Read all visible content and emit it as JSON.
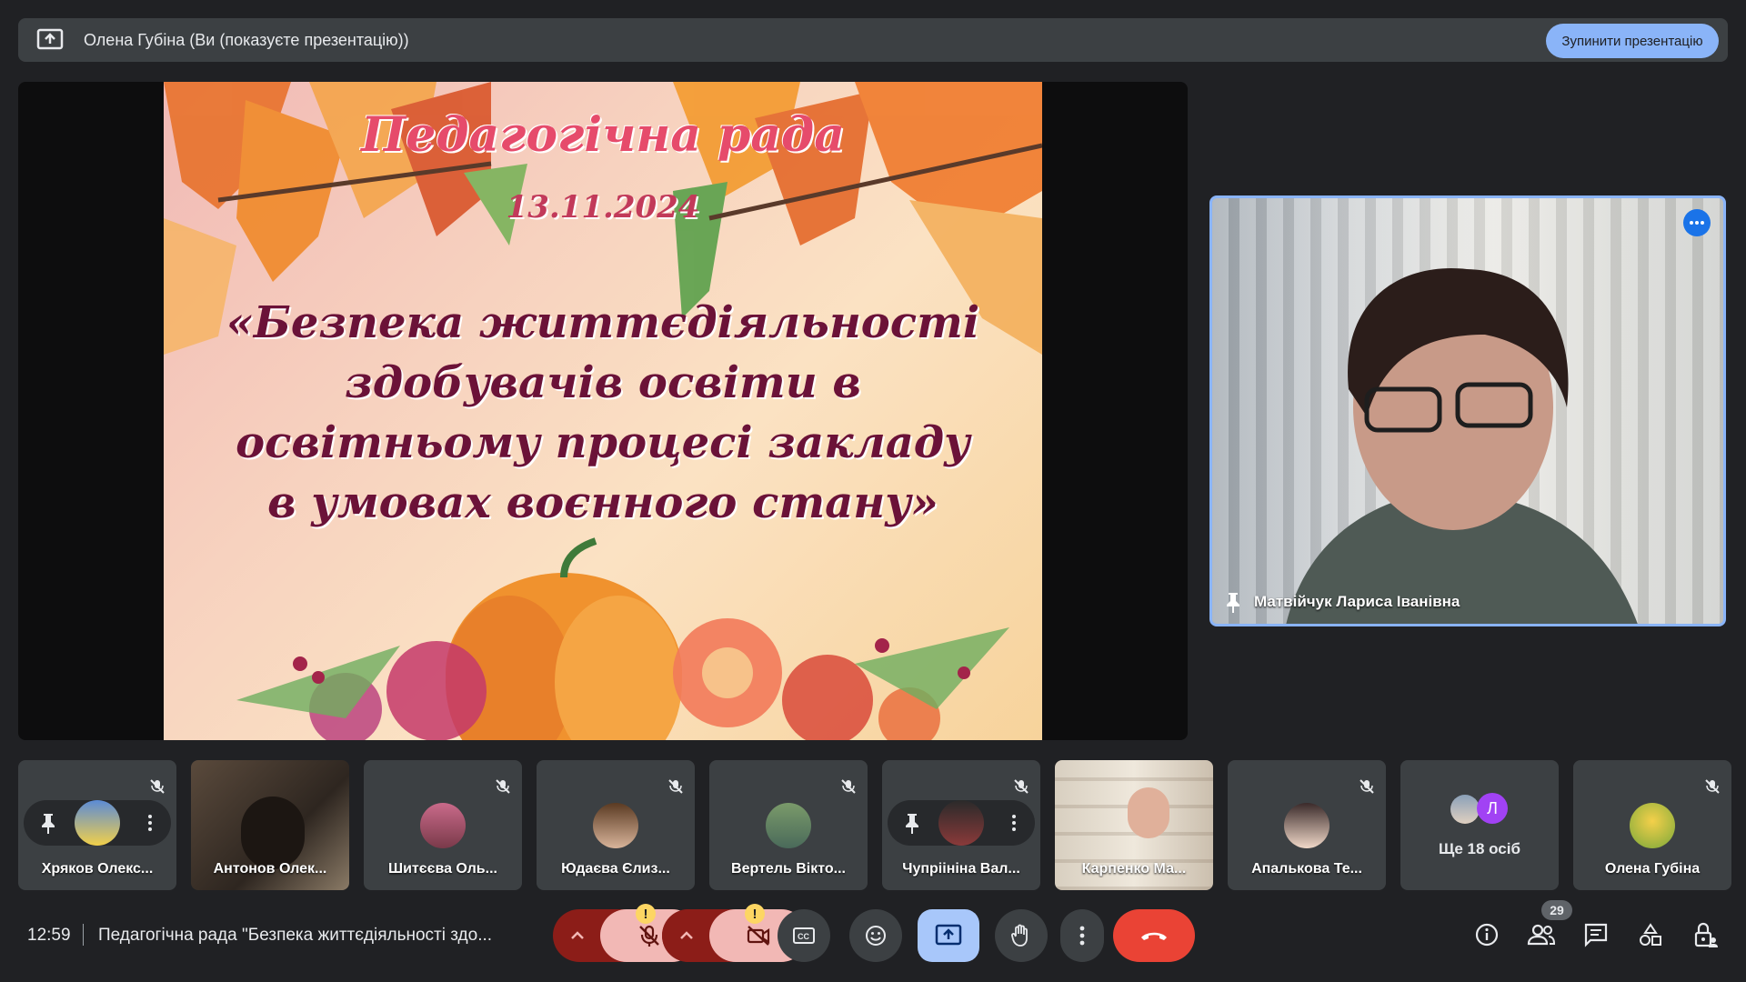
{
  "presenting_bar": {
    "label": "Олена Губіна (Ви (показуєте презентацію))",
    "stop_button": "Зупинити презентацію"
  },
  "slide": {
    "title": "Педагогічна рада",
    "date": "13.11.2024",
    "subtitle": "«Безпека життєдіяльності здобувачів освіти в освітньому процесі закладу в умовах воєнного стану»"
  },
  "pinned_speaker": {
    "name": "Матвійчук Лариса Іванівна"
  },
  "participants": [
    {
      "name": "Хряков Олекс...",
      "muted": true
    },
    {
      "name": "Антонов Олек...",
      "muted": false
    },
    {
      "name": "Шитєєва Оль...",
      "muted": true
    },
    {
      "name": "Юдаєва Єлиз...",
      "muted": true
    },
    {
      "name": "Вертель Вікто...",
      "muted": true
    },
    {
      "name": "Чупріініна Вал...",
      "muted": true
    },
    {
      "name": "Карпенко Ма...",
      "muted": false
    },
    {
      "name": "Апалькова Те...",
      "muted": true
    },
    {
      "more": "Ще 18 осіб",
      "initial": "Л"
    },
    {
      "name": "Олена Губіна",
      "muted": true
    }
  ],
  "bottom_bar": {
    "time": "12:59",
    "meeting_title": "Педагогічна рада \"Безпека життєдіяльності здо...",
    "participants_count": "29",
    "warn_mark": "!"
  },
  "colors": {
    "background": "#202124",
    "tile": "#3c4043",
    "accent": "#8ab4f8",
    "end_call": "#ea4335"
  }
}
